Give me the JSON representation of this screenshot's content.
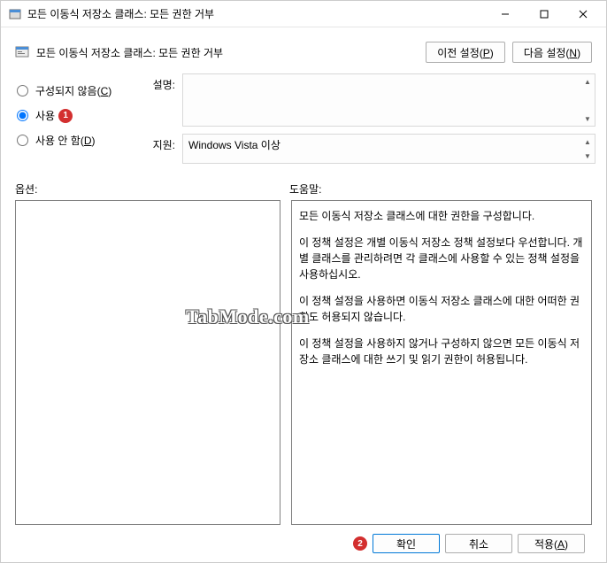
{
  "window": {
    "title": "모든 이동식 저장소 클래스: 모든 권한 거부"
  },
  "header": {
    "setting_title": "모든 이동식 저장소 클래스: 모든 권한 거부",
    "prev_btn": "이전 설정(P)",
    "next_btn": "다음 설정(N)"
  },
  "radios": {
    "not_configured": "구성되지 않음(C)",
    "enabled": "사용",
    "disabled": "사용 안 함(D)",
    "selected": "enabled"
  },
  "badges": {
    "one": "1",
    "two": "2"
  },
  "fields": {
    "description_label": "설명:",
    "supported_label": "지원:",
    "supported_value": "Windows Vista 이상"
  },
  "section": {
    "options": "옵션:",
    "help": "도움말:"
  },
  "help_text": {
    "p1": "모든 이동식 저장소 클래스에 대한 권한을 구성합니다.",
    "p2": "이 정책 설정은 개별 이동식 저장소 정책 설정보다 우선합니다. 개별 클래스를 관리하려면 각 클래스에 사용할 수 있는 정책 설정을 사용하십시오.",
    "p3": "이 정책 설정을 사용하면 이동식 저장소 클래스에 대한 어떠한 권한도 허용되지 않습니다.",
    "p4": "이 정책 설정을 사용하지 않거나 구성하지 않으면 모든 이동식 저장소 클래스에 대한 쓰기 및 읽기 권한이 허용됩니다."
  },
  "buttons": {
    "ok": "확인",
    "cancel": "취소",
    "apply": "적용(A)"
  },
  "watermark": "TabMode.com"
}
